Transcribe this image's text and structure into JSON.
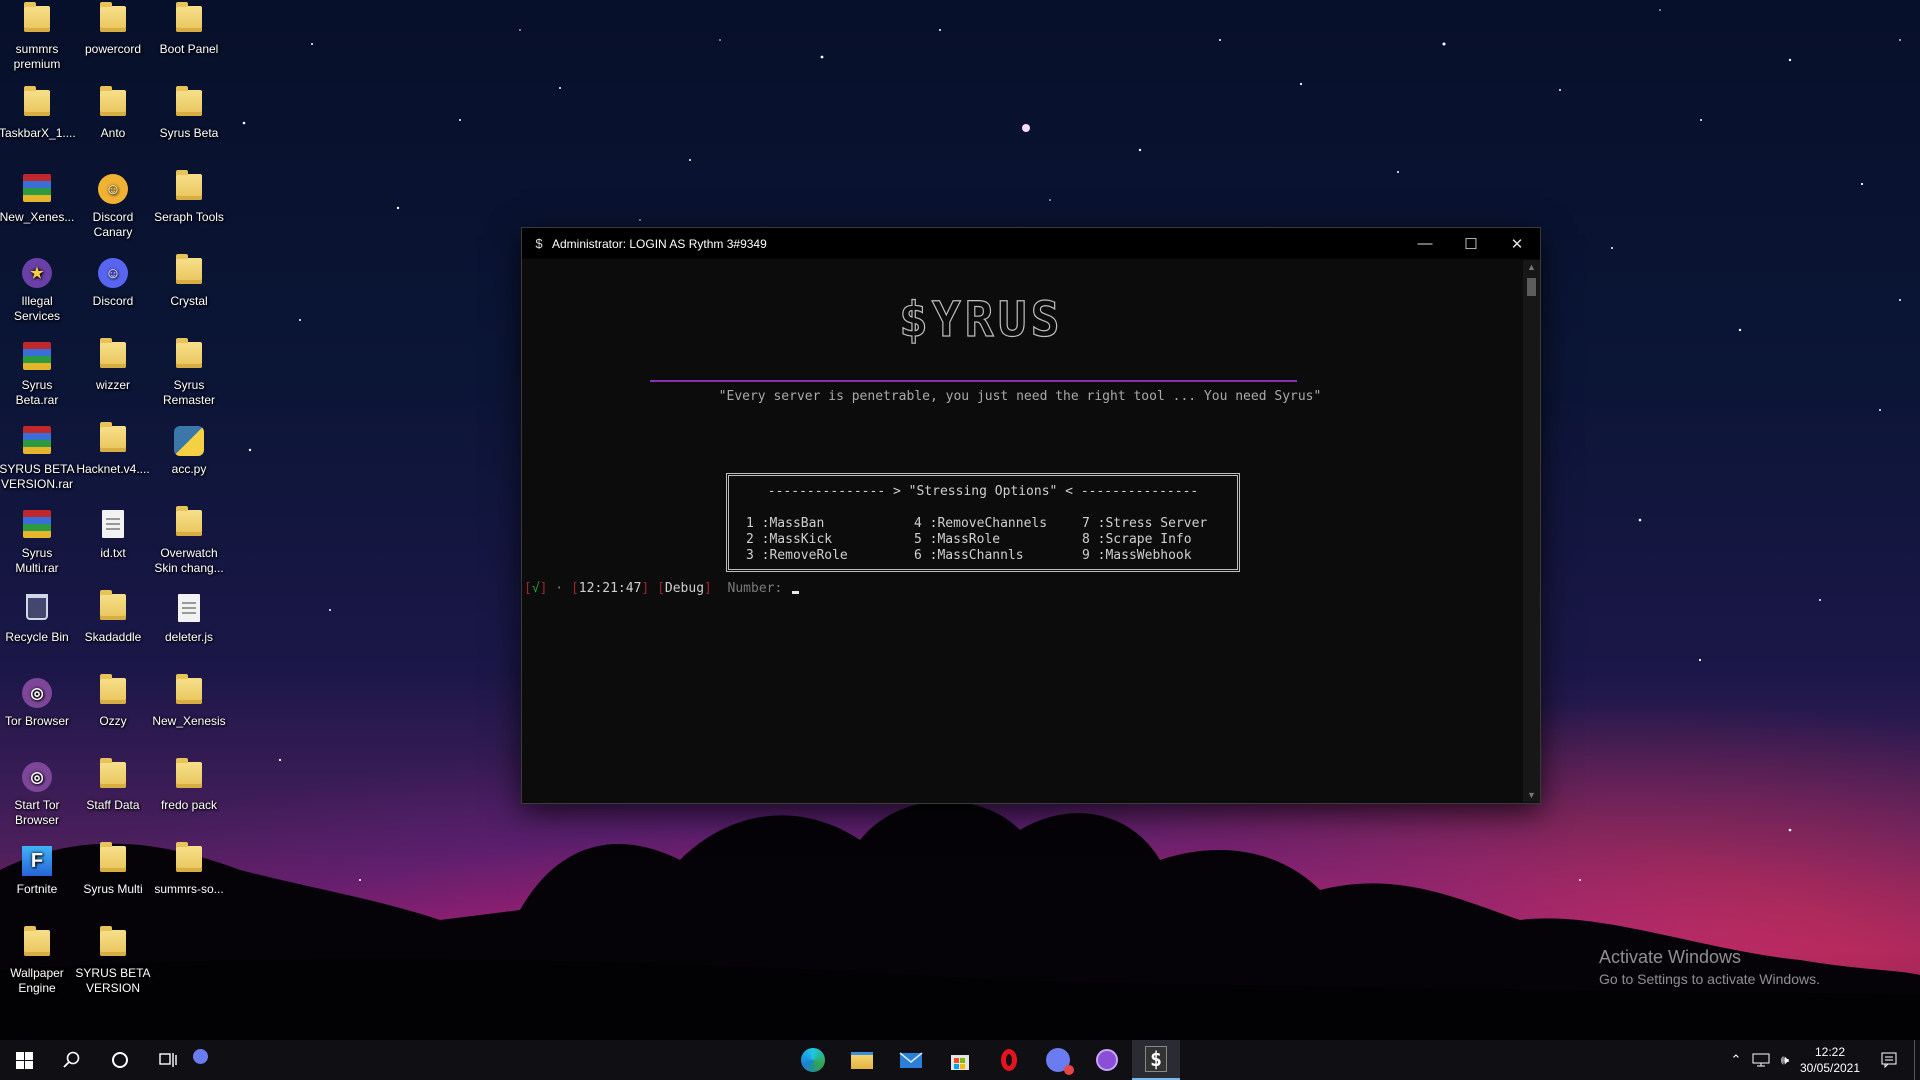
{
  "desktop": {
    "icons": [
      {
        "label": "summrs premium",
        "type": "folder"
      },
      {
        "label": "powercord",
        "type": "folder"
      },
      {
        "label": "Boot Panel",
        "type": "folder"
      },
      {
        "label": "TaskbarX_1....",
        "type": "folder"
      },
      {
        "label": "Anto",
        "type": "folder"
      },
      {
        "label": "Syrus Beta",
        "type": "folder"
      },
      {
        "label": "New_Xenes...",
        "type": "rar"
      },
      {
        "label": "Discord Canary",
        "type": "canary"
      },
      {
        "label": "Seraph Tools",
        "type": "folder"
      },
      {
        "label": "Illegal Services",
        "type": "app"
      },
      {
        "label": "Discord",
        "type": "discord"
      },
      {
        "label": "Crystal",
        "type": "folder"
      },
      {
        "label": "Syrus Beta.rar",
        "type": "rar"
      },
      {
        "label": "wizzer",
        "type": "folder"
      },
      {
        "label": "Syrus Remaster",
        "type": "folder"
      },
      {
        "label": "SYRUS BETA VERSION.rar",
        "type": "rar"
      },
      {
        "label": "Hacknet.v4....",
        "type": "folder"
      },
      {
        "label": "acc.py",
        "type": "python"
      },
      {
        "label": "Syrus Multi.rar",
        "type": "rar"
      },
      {
        "label": "id.txt",
        "type": "file"
      },
      {
        "label": "Overwatch Skin chang...",
        "type": "folder"
      },
      {
        "label": "Recycle Bin",
        "type": "bin"
      },
      {
        "label": "Skadaddle",
        "type": "folder"
      },
      {
        "label": "deleter.js",
        "type": "file"
      },
      {
        "label": "Tor Browser",
        "type": "tor"
      },
      {
        "label": "Ozzy",
        "type": "folder"
      },
      {
        "label": "New_Xenesis",
        "type": "folder"
      },
      {
        "label": "Start Tor Browser",
        "type": "tor"
      },
      {
        "label": "Staff Data",
        "type": "folder"
      },
      {
        "label": "fredo pack",
        "type": "folder"
      },
      {
        "label": "Fortnite",
        "type": "fortnite"
      },
      {
        "label": "Syrus Multi",
        "type": "folder"
      },
      {
        "label": "summrs-so...",
        "type": "folder"
      },
      {
        "label": "Wallpaper Engine",
        "type": "folder"
      },
      {
        "label": "SYRUS BETA VERSION",
        "type": "folder"
      }
    ]
  },
  "window": {
    "title": "Administrator:  LOGIN AS  Rythm 3#9349",
    "icon": "dollar-icon",
    "minimize": "—",
    "maximize": "☐",
    "close": "✕"
  },
  "terminal": {
    "logo": "$YRUS",
    "quote": "\"Every server is penetrable, you just need the right tool ... You need Syrus\"",
    "menu_header": "--------------- > \"Stressing Options\" < ---------------",
    "options": [
      "1 :MassBan",
      "2 :MassKick",
      "3 :RemoveRole",
      "4 :RemoveChannels",
      "5 :MassRole",
      "6 :MassChannls",
      "7 :Stress Server",
      "8 :Scrape Info",
      "9 :MassWebhook"
    ],
    "prompt": {
      "open1": "[",
      "check": "√",
      "close1": "]",
      "sep": " · ",
      "open2": "[",
      "time": "12:21:47",
      "close2": "]",
      "open3": "[",
      "mode": "Debug",
      "close3": "]",
      "label": "Number:"
    }
  },
  "watermark": {
    "line1": "Activate Windows",
    "line2": "Go to Settings to activate Windows."
  },
  "taskbar": {
    "apps": [
      "start-icon",
      "search-icon",
      "cortana-icon",
      "task-view-icon",
      "discord-mini-icon",
      "edge-icon",
      "file-explorer-icon",
      "mail-icon",
      "store-icon",
      "opera-icon",
      "discord-icon",
      "github-icon",
      "syrus-terminal-icon"
    ],
    "clock": {
      "time": "12:22",
      "date": "30/05/2021"
    }
  },
  "colors": {
    "accent": "#8b2fb0",
    "terminal_bg": "#0c0c0c",
    "taskbar": "#101014"
  }
}
